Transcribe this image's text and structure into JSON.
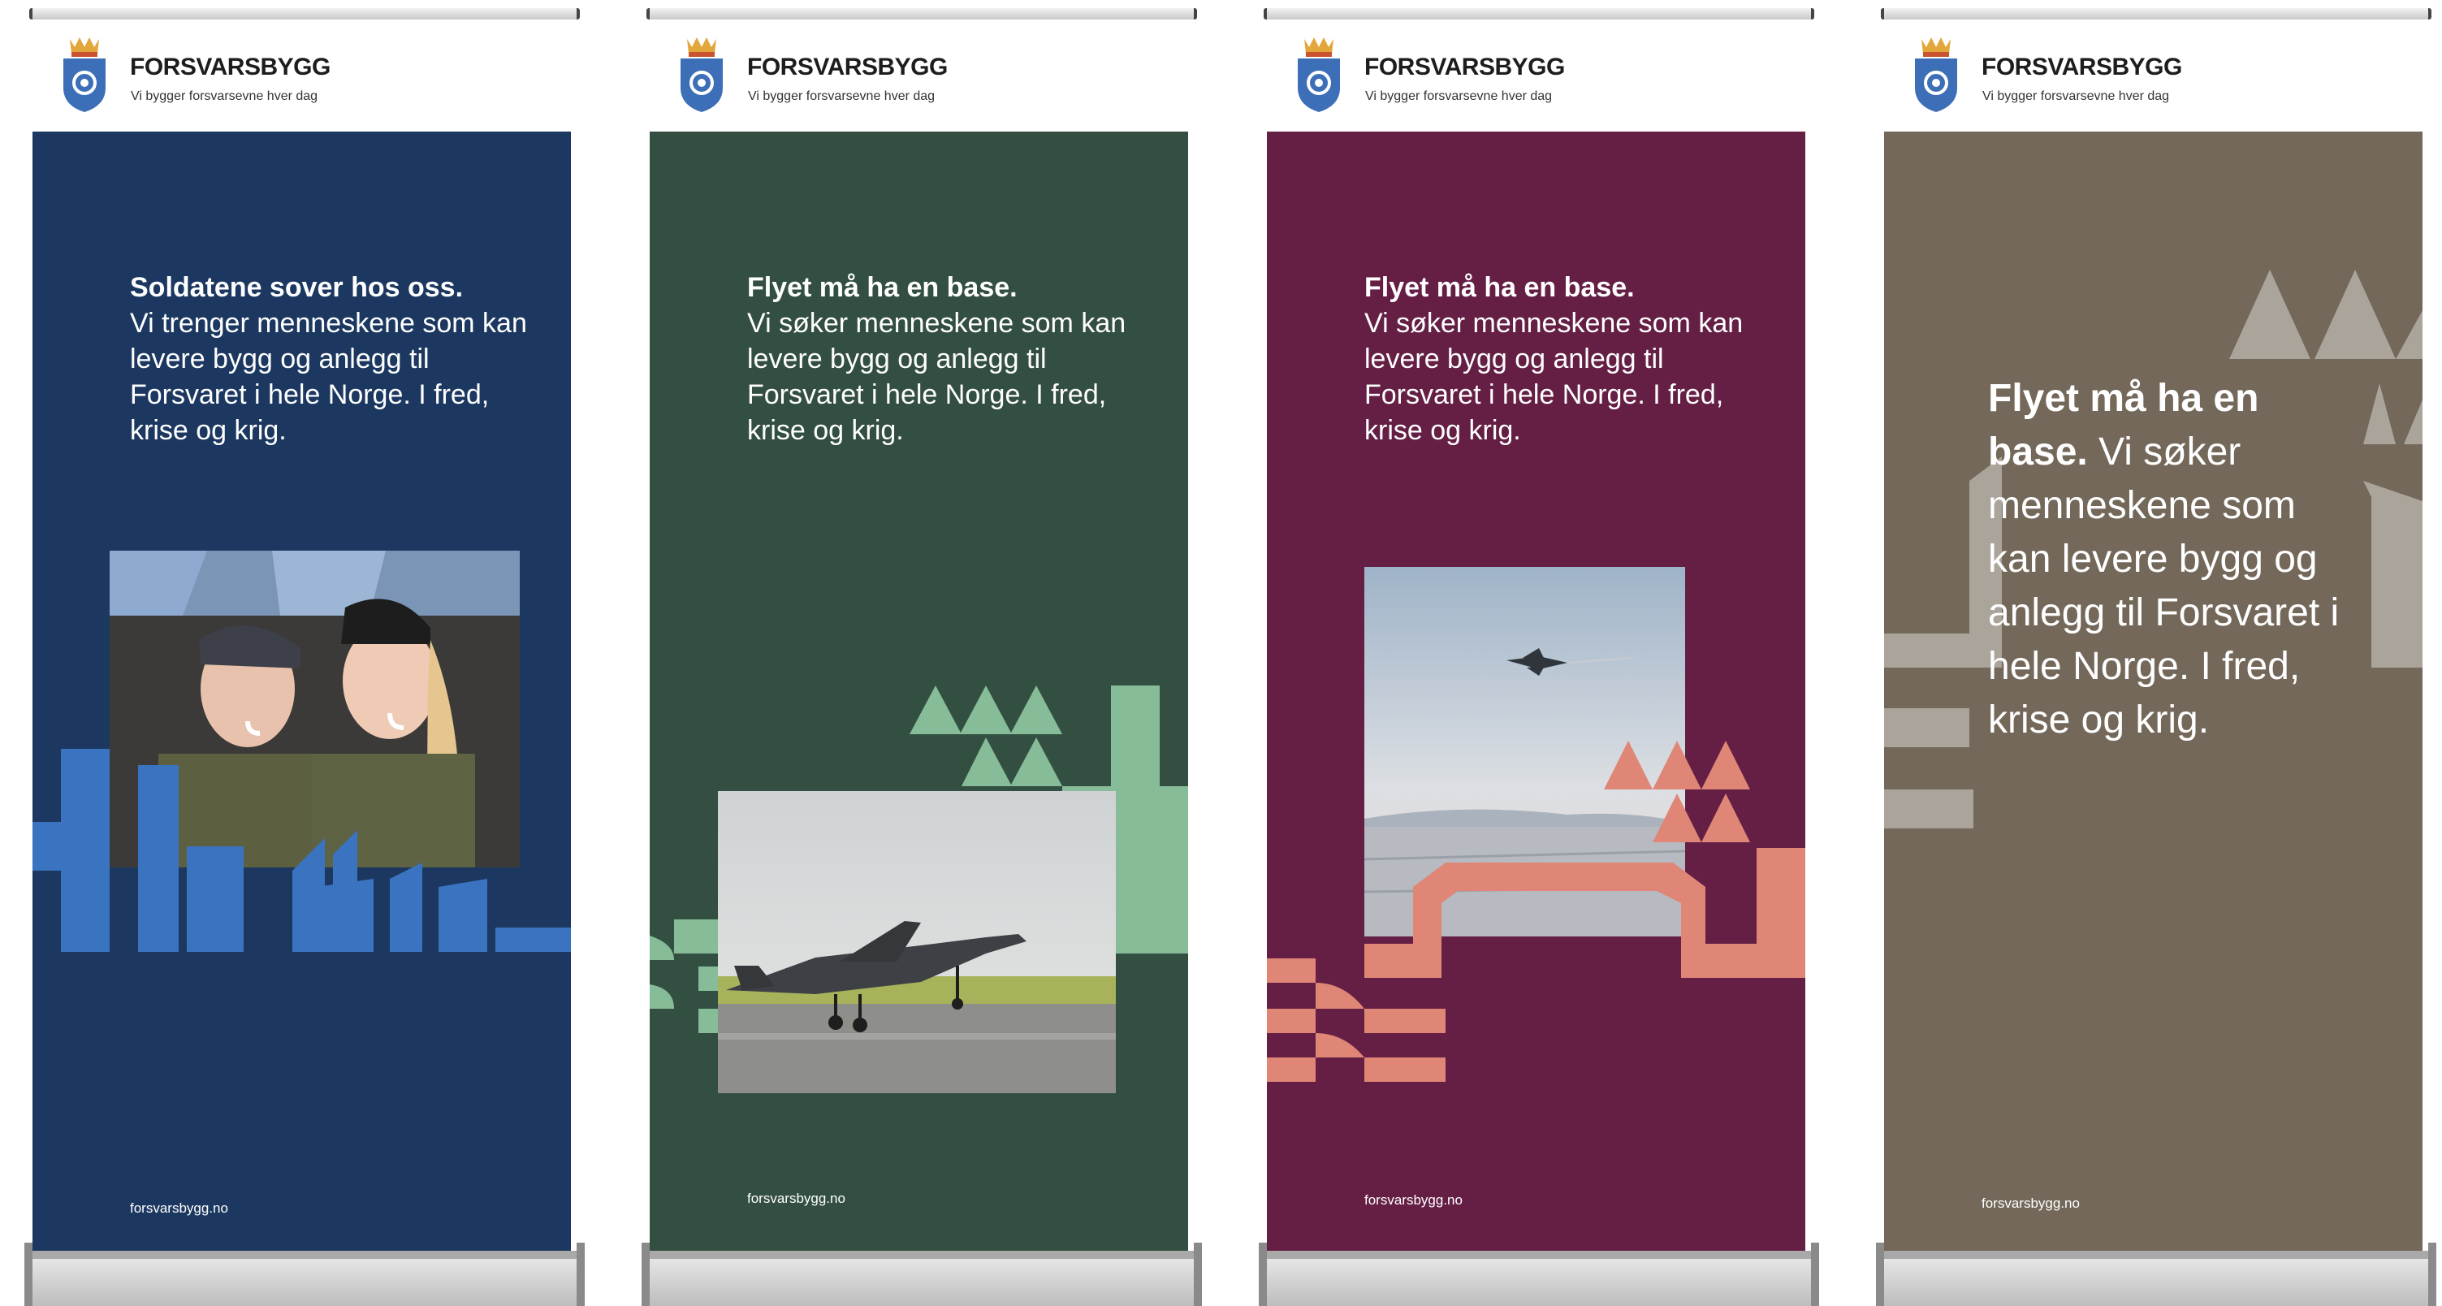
{
  "brand": {
    "name": "FORSVARSBYGG",
    "tagline": "Vi bygger forsvarsevne hver dag",
    "crest_icon": "norwegian-crown-crest-icon"
  },
  "banners": [
    {
      "headline": "Soldatene sover hos oss.",
      "body": "Vi trenger menneskene som kan levere bygg og anlegg til Forsvaret i hele Norge. I fred, krise og krig.",
      "url": "forsvarsbygg.no",
      "background": "#1c3861",
      "accent": "#3a73c0",
      "photo": "two-smiling-soldiers-in-berets"
    },
    {
      "headline": "Flyet må ha en base.",
      "body": "Vi søker menneskene som kan levere bygg og anlegg til Forsvaret i hele Norge. I fred, krise og krig.",
      "url": "forsvarsbygg.no",
      "background": "#334f41",
      "accent": "#86bd98",
      "photo": "fighter-jet-taking-off-from-runway"
    },
    {
      "headline": "Flyet må ha en base.",
      "body": "Vi søker menneskene som kan levere bygg og anlegg til Forsvaret i hele Norge. I fred, krise og krig.",
      "url": "forsvarsbygg.no",
      "background": "#651f45",
      "accent": "#df8677",
      "photo": "fighter-jet-over-snowy-airfield"
    },
    {
      "headline": "Flyet må ha en base.",
      "body": "Vi søker menneskene som kan levere bygg og anlegg til Forsvaret i hele Norge. I fred, krise og krig.",
      "url": "forsvarsbygg.no",
      "background": "#736859",
      "accent": "#aaa49a",
      "photo": ""
    }
  ]
}
